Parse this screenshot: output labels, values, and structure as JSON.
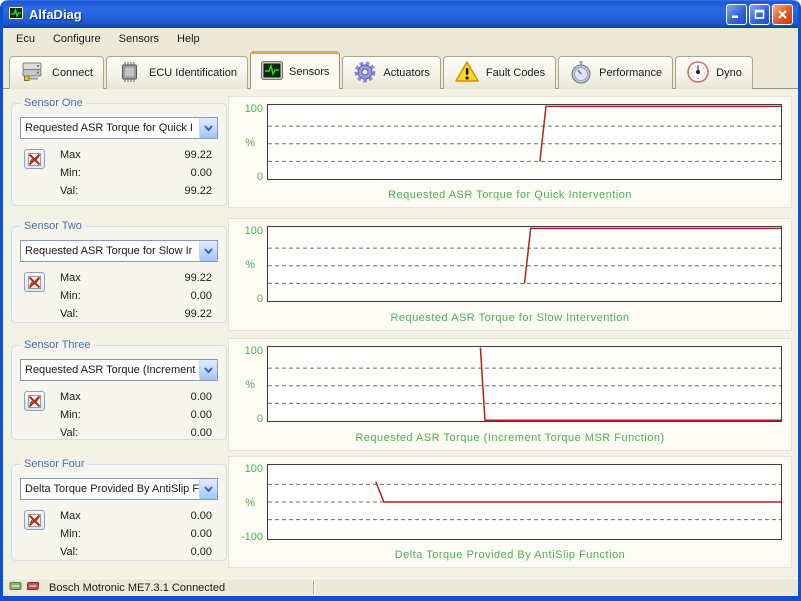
{
  "window": {
    "title": "AlfaDiag"
  },
  "menu": {
    "items": [
      "Ecu",
      "Configure",
      "Sensors",
      "Help"
    ]
  },
  "toolbar": {
    "tabs": [
      {
        "label": "Connect"
      },
      {
        "label": "ECU Identification"
      },
      {
        "label": "Sensors",
        "active": true
      },
      {
        "label": "Actuators"
      },
      {
        "label": "Fault Codes"
      },
      {
        "label": "Performance"
      },
      {
        "label": "Dyno"
      }
    ]
  },
  "sensors": [
    {
      "caption": "Sensor One",
      "selected": "Requested ASR Torque for Quick I",
      "stats": [
        {
          "label": "Max",
          "value": "99.22"
        },
        {
          "label": "Min:",
          "value": "0.00"
        },
        {
          "label": "Val:",
          "value": "99.22"
        }
      ]
    },
    {
      "caption": "Sensor Two",
      "selected": "Requested ASR Torque for Slow Ir",
      "stats": [
        {
          "label": "Max",
          "value": "99.22"
        },
        {
          "label": "Min:",
          "value": "0.00"
        },
        {
          "label": "Val:",
          "value": "99.22"
        }
      ]
    },
    {
      "caption": "Sensor Three",
      "selected": "Requested ASR Torque (Increment",
      "stats": [
        {
          "label": "Max",
          "value": "0.00"
        },
        {
          "label": "Min:",
          "value": "0.00"
        },
        {
          "label": "Val:",
          "value": "0.00"
        }
      ]
    },
    {
      "caption": "Sensor Four",
      "selected": "Delta Torque Provided By AntiSlip F",
      "stats": [
        {
          "label": "Max",
          "value": "0.00"
        },
        {
          "label": "Min:",
          "value": "0.00"
        },
        {
          "label": "Val:",
          "value": "0.00"
        }
      ]
    }
  ],
  "chart_data": [
    {
      "type": "line",
      "title": "Requested ASR Torque for Quick Intervention",
      "ylabel": "%",
      "ylim": [
        0,
        105
      ],
      "yticks": [
        {
          "value": 100,
          "label": "100"
        },
        {
          "value": 0,
          "label": "0"
        }
      ],
      "gridlines": [
        75,
        50,
        25
      ],
      "line_color": "#b22222",
      "text_color": "#57ab57",
      "points": [
        [
          0.53,
          25
        ],
        [
          0.542,
          103
        ],
        [
          1,
          103
        ]
      ]
    },
    {
      "type": "line",
      "title": "Requested ASR Torque for Slow Intervention",
      "ylabel": "%",
      "ylim": [
        0,
        105
      ],
      "yticks": [
        {
          "value": 100,
          "label": "100"
        },
        {
          "value": 0,
          "label": "0"
        }
      ],
      "gridlines": [
        75,
        50,
        25
      ],
      "line_color": "#b22222",
      "text_color": "#57ab57",
      "points": [
        [
          0.5,
          25
        ],
        [
          0.512,
          103
        ],
        [
          1,
          103
        ]
      ]
    },
    {
      "type": "line",
      "title": "Requested ASR Torque (Increment Torque MSR Function)",
      "ylabel": "%",
      "ylim": [
        0,
        105
      ],
      "yticks": [
        {
          "value": 100,
          "label": "100"
        },
        {
          "value": 0,
          "label": "0"
        }
      ],
      "gridlines": [
        75,
        50,
        25
      ],
      "line_color": "#b22222",
      "text_color": "#57ab57",
      "points": [
        [
          0.414,
          104
        ],
        [
          0.423,
          1
        ],
        [
          1,
          1
        ]
      ]
    },
    {
      "type": "line",
      "title": "Delta Torque Provided By AntiSlip Function",
      "ylabel": "%",
      "ylim": [
        -105,
        105
      ],
      "yticks": [
        {
          "value": 100,
          "label": "100"
        },
        {
          "value": -100,
          "label": "-100"
        }
      ],
      "gridlines": [
        50,
        0,
        -50
      ],
      "line_color": "#b22222",
      "text_color": "#57ab57",
      "points": [
        [
          0.21,
          58
        ],
        [
          0.226,
          0
        ],
        [
          1,
          0
        ]
      ]
    }
  ],
  "status_bar": {
    "text": "Bosch Motronic ME7.3.1 Connected"
  },
  "colors": {
    "active_tab_accent": "#f0a048",
    "trace_red": "#b22222",
    "chart_text_green": "#57ab57",
    "groupbox_caption_blue": "#4a6fb0",
    "titlebar_blue": "#2261de"
  }
}
